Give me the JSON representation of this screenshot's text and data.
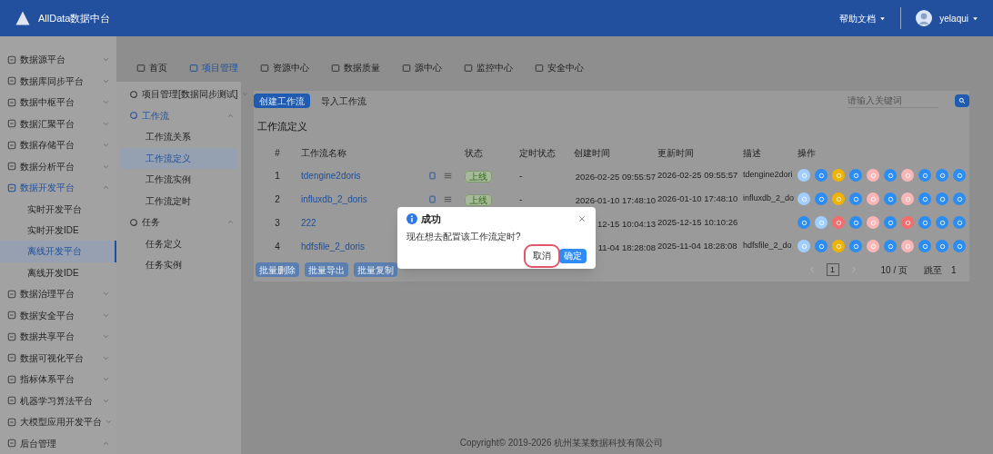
{
  "header": {
    "logo": "AllData数据中台",
    "help": "帮助文档",
    "user": "yelaqui"
  },
  "sidebar": {
    "items": [
      {
        "label": "数据源平台",
        "expanded": false,
        "selected": false
      },
      {
        "label": "数据库同步平台",
        "expanded": false,
        "selected": false
      },
      {
        "label": "数据中枢平台",
        "expanded": false,
        "selected": false
      },
      {
        "label": "数据汇聚平台",
        "expanded": false,
        "selected": false
      },
      {
        "label": "数据存储平台",
        "expanded": false,
        "selected": false
      },
      {
        "label": "数据分析平台",
        "expanded": false,
        "selected": false
      },
      {
        "label": "数据开发平台",
        "expanded": true,
        "selected": false,
        "children": [
          {
            "label": "实时开发平台",
            "selected": false
          },
          {
            "label": "实时开发IDE",
            "selected": false
          },
          {
            "label": "离线开发平台",
            "selected": true
          },
          {
            "label": "离线开发IDE",
            "selected": false
          }
        ]
      },
      {
        "label": "数据治理平台",
        "expanded": false,
        "selected": false
      },
      {
        "label": "数据安全平台",
        "expanded": false,
        "selected": false
      },
      {
        "label": "数据共享平台",
        "expanded": false,
        "selected": false
      },
      {
        "label": "数据可视化平台",
        "expanded": false,
        "selected": false
      },
      {
        "label": "指标体系平台",
        "expanded": false,
        "selected": false
      },
      {
        "label": "机器学习算法平台",
        "expanded": false,
        "selected": false
      },
      {
        "label": "大模型应用开发平台",
        "expanded": false,
        "selected": false
      },
      {
        "label": "后台管理",
        "expanded": true,
        "selected": false
      }
    ]
  },
  "nav_tabs": [
    {
      "label": "首页",
      "selected": false
    },
    {
      "label": "项目管理",
      "selected": true
    },
    {
      "label": "资源中心",
      "selected": false
    },
    {
      "label": "数据质量",
      "selected": false
    },
    {
      "label": "源中心",
      "selected": false
    },
    {
      "label": "监控中心",
      "selected": false
    },
    {
      "label": "安全中心",
      "selected": false
    }
  ],
  "project_menu": {
    "items": [
      {
        "label": "项目管理[数据同步测试]",
        "expanded": false
      },
      {
        "label": "工作流",
        "expanded": true,
        "children": [
          {
            "label": "工作流关系",
            "selected": false
          },
          {
            "label": "工作流定义",
            "selected": true
          },
          {
            "label": "工作流实例",
            "selected": false
          },
          {
            "label": "工作流定时",
            "selected": false
          }
        ]
      },
      {
        "label": "任务",
        "expanded": true,
        "children": [
          {
            "label": "任务定义",
            "selected": false
          },
          {
            "label": "任务实例",
            "selected": false
          }
        ]
      }
    ]
  },
  "toolbar": {
    "create": "创建工作流",
    "import": "导入工作流",
    "search": {
      "placeholder": "请输入关键词"
    }
  },
  "section_title": "工作流定义",
  "table": {
    "columns": [
      "#",
      "工作流名称",
      "状态",
      "定时状态",
      "创建时间",
      "更新时间",
      "描述",
      "操作"
    ],
    "rows": [
      {
        "index": "1",
        "name": "tdengine2doris",
        "status": "上线",
        "schedule": "-",
        "created": "2026-02-25 09:55:57",
        "updated": "2026-02-25 09:55:57",
        "description": "tdengine2dori",
        "actions": [
          {
            "color": "#a0cfff"
          },
          {
            "color": "#2d8cf0"
          },
          {
            "color": "#f0b400"
          },
          {
            "color": "#2d8cf0"
          },
          {
            "color": "#fab6b6"
          },
          {
            "color": "#2d8cf0"
          },
          {
            "color": "#fab6b6"
          },
          {
            "color": "#2d8cf0"
          },
          {
            "color": "#2d8cf0"
          },
          {
            "color": "#2d8cf0"
          }
        ]
      },
      {
        "index": "2",
        "name": "influxdb_2_doris",
        "status": "上线",
        "schedule": "-",
        "created": "2026-01-10 17:48:10",
        "updated": "2026-01-10 17:48:10",
        "description": "influxdb_2_do",
        "actions": [
          {
            "color": "#a0cfff"
          },
          {
            "color": "#2d8cf0"
          },
          {
            "color": "#f0b400"
          },
          {
            "color": "#2d8cf0"
          },
          {
            "color": "#fab6b6"
          },
          {
            "color": "#2d8cf0"
          },
          {
            "color": "#fab6b6"
          },
          {
            "color": "#2d8cf0"
          },
          {
            "color": "#2d8cf0"
          },
          {
            "color": "#2d8cf0"
          }
        ]
      },
      {
        "index": "3",
        "name": "222",
        "created": "12-15 10:04:13",
        "updated": "2025-12-15 10:10:26",
        "actions": [
          {
            "color": "#2d8cf0"
          },
          {
            "color": "#a0cfff"
          },
          {
            "color": "#f56c6c"
          },
          {
            "color": "#2d8cf0"
          },
          {
            "color": "#fab6b6"
          },
          {
            "color": "#2d8cf0"
          },
          {
            "color": "#f56c6c"
          },
          {
            "color": "#2d8cf0"
          },
          {
            "color": "#2d8cf0"
          },
          {
            "color": "#2d8cf0"
          }
        ]
      },
      {
        "index": "4",
        "name": "hdfsfile_2_doris",
        "created": "11-04 18:28:08",
        "updated": "2025-11-04 18:28:08",
        "description": "hdfsfile_2_do",
        "actions": [
          {
            "color": "#a0cfff"
          },
          {
            "color": "#2d8cf0"
          },
          {
            "color": "#f0b400"
          },
          {
            "color": "#2d8cf0"
          },
          {
            "color": "#fab6b6"
          },
          {
            "color": "#2d8cf0"
          },
          {
            "color": "#fab6b6"
          },
          {
            "color": "#2d8cf0"
          },
          {
            "color": "#2d8cf0"
          },
          {
            "color": "#2d8cf0"
          }
        ]
      }
    ]
  },
  "batch_buttons": [
    "批量删除",
    "批量导出",
    "批量复制"
  ],
  "pagination": {
    "page": "1",
    "page_size": "10 / 页",
    "jump_label": "跳至",
    "jump_value": "1"
  },
  "footer": "Copyright© 2019-2026 杭州某某数据科技有限公司",
  "dialog": {
    "title": "成功",
    "message": "现在想去配置该工作流定时?",
    "buttons": [
      {
        "label": "取消",
        "kind": "default",
        "highlighted": true
      },
      {
        "label": "确定",
        "kind": "primary",
        "highlighted": false
      }
    ]
  }
}
